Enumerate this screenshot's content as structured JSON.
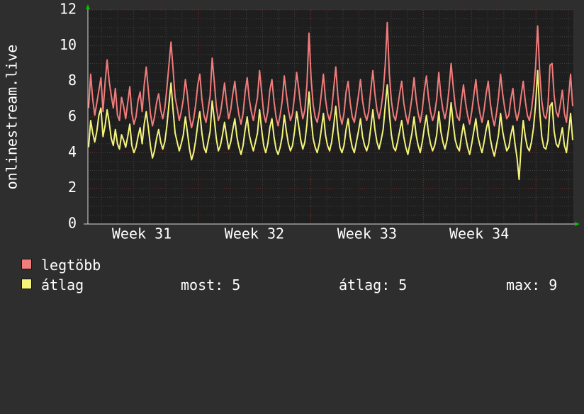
{
  "chart_data": {
    "type": "line",
    "ylabel": "onlinestream.live",
    "ylim": [
      0,
      12
    ],
    "yticks": [
      0,
      2,
      4,
      6,
      8,
      10,
      12
    ],
    "x_ticks": [
      "Week 31",
      "Week 32",
      "Week 33",
      "Week 34"
    ],
    "x_tick_positions": [
      0.111,
      0.343,
      0.575,
      0.806
    ],
    "grid": true,
    "series": [
      {
        "name": "legtöbb",
        "color": "#f07c7c",
        "values": [
          6.5,
          8.4,
          7.0,
          6.1,
          6.8,
          7.5,
          8.2,
          6.3,
          7.9,
          9.2,
          8.0,
          7.2,
          6.5,
          7.6,
          6.1,
          5.8,
          7.1,
          6.6,
          5.9,
          6.8,
          7.7,
          6.2,
          5.6,
          6.0,
          6.9,
          7.4,
          6.3,
          7.8,
          8.8,
          7.5,
          6.2,
          5.5,
          6.0,
          6.8,
          7.3,
          6.4,
          5.9,
          6.5,
          7.6,
          8.9,
          10.2,
          8.7,
          7.1,
          6.5,
          5.8,
          6.3,
          7.0,
          8.1,
          7.2,
          6.0,
          5.4,
          5.9,
          6.7,
          7.8,
          8.4,
          7.0,
          6.1,
          5.7,
          6.4,
          7.2,
          9.3,
          8.0,
          6.6,
          5.8,
          6.2,
          7.0,
          7.9,
          6.8,
          5.9,
          6.4,
          7.3,
          8.0,
          6.9,
          6.1,
          5.6,
          6.2,
          7.4,
          8.2,
          7.0,
          6.3,
          5.8,
          6.5,
          7.1,
          8.6,
          7.4,
          6.2,
          5.7,
          6.3,
          7.5,
          8.1,
          6.9,
          6.0,
          5.5,
          6.1,
          6.9,
          8.3,
          7.3,
          6.4,
          5.8,
          6.2,
          7.2,
          8.5,
          7.6,
          6.6,
          5.9,
          6.4,
          7.8,
          10.7,
          8.2,
          6.7,
          6.0,
          5.7,
          6.3,
          7.3,
          8.4,
          7.0,
          6.2,
          5.8,
          6.4,
          7.6,
          8.8,
          7.2,
          6.1,
          5.6,
          6.2,
          7.4,
          8.0,
          6.8,
          6.0,
          5.7,
          6.4,
          7.2,
          8.1,
          6.9,
          6.2,
          5.8,
          6.3,
          7.5,
          8.6,
          7.3,
          6.4,
          5.9,
          6.5,
          7.4,
          8.9,
          11.3,
          8.4,
          6.9,
          6.1,
          5.8,
          6.5,
          7.3,
          8.0,
          6.8,
          6.1,
          5.6,
          6.3,
          7.1,
          8.2,
          7.0,
          6.2,
          5.7,
          6.4,
          7.5,
          8.3,
          7.1,
          6.3,
          5.8,
          6.2,
          7.0,
          8.5,
          7.2,
          6.4,
          5.9,
          6.5,
          7.6,
          9.0,
          7.7,
          6.6,
          6.0,
          5.8,
          6.9,
          7.8,
          6.8,
          6.1,
          5.6,
          6.3,
          7.2,
          8.1,
          6.9,
          6.2,
          5.7,
          6.4,
          7.3,
          8.0,
          6.8,
          6.0,
          5.5,
          6.2,
          7.1,
          8.4,
          7.3,
          6.5,
          5.9,
          6.1,
          7.0,
          7.6,
          6.4,
          5.8,
          6.3,
          7.2,
          8.0,
          6.9,
          6.1,
          5.8,
          6.4,
          7.4,
          8.8,
          11.1,
          8.5,
          6.9,
          6.1,
          5.9,
          6.6,
          8.9,
          9.0,
          7.2,
          6.3,
          6.0,
          6.7,
          7.5,
          6.2,
          5.7,
          7.1,
          8.4,
          6.6
        ]
      },
      {
        "name": "átlag",
        "color": "#f4f47a",
        "values": [
          4.3,
          5.8,
          5.1,
          4.6,
          5.2,
          6.1,
          6.5,
          4.9,
          5.5,
          6.4,
          5.7,
          4.8,
          4.4,
          5.3,
          4.5,
          4.2,
          5.0,
          4.7,
          4.3,
          4.9,
          5.6,
          4.4,
          4.0,
          4.3,
          4.9,
          5.4,
          4.5,
          5.6,
          6.3,
          5.4,
          4.4,
          3.7,
          4.1,
          4.8,
          5.3,
          4.6,
          4.2,
          4.6,
          5.5,
          6.7,
          7.9,
          6.4,
          5.1,
          4.6,
          4.1,
          4.5,
          5.0,
          6.0,
          5.1,
          4.2,
          3.6,
          4.0,
          4.7,
          5.6,
          6.3,
          5.1,
          4.3,
          4.0,
          4.6,
          5.2,
          6.9,
          5.9,
          4.8,
          4.1,
          4.4,
          5.0,
          5.7,
          4.9,
          4.2,
          4.6,
          5.3,
          5.9,
          4.9,
          4.3,
          3.9,
          4.4,
          5.3,
          6.0,
          5.0,
          4.5,
          4.1,
          4.6,
          5.1,
          6.4,
          5.3,
          4.4,
          4.0,
          4.5,
          5.4,
          5.9,
          4.9,
          4.2,
          3.9,
          4.3,
          4.9,
          6.1,
          5.2,
          4.5,
          4.1,
          4.4,
          5.2,
          6.3,
          5.5,
          4.7,
          4.2,
          4.6,
          5.6,
          7.4,
          6.0,
          4.8,
          4.3,
          4.0,
          4.5,
          5.3,
          6.2,
          5.0,
          4.4,
          4.1,
          4.6,
          5.5,
          6.6,
          5.2,
          4.3,
          4.0,
          4.4,
          5.3,
          5.9,
          4.9,
          4.3,
          4.0,
          4.6,
          5.2,
          5.9,
          4.9,
          4.4,
          4.1,
          4.5,
          5.4,
          6.4,
          5.3,
          4.6,
          4.2,
          4.7,
          5.3,
          6.6,
          7.8,
          6.2,
          5.0,
          4.3,
          4.1,
          4.6,
          5.2,
          5.8,
          4.9,
          4.3,
          3.9,
          4.5,
          5.1,
          6.0,
          5.0,
          4.4,
          4.0,
          4.6,
          5.4,
          6.1,
          5.1,
          4.5,
          4.1,
          4.4,
          5.0,
          6.3,
          5.2,
          4.6,
          4.2,
          4.7,
          5.5,
          6.8,
          5.6,
          4.7,
          4.3,
          4.1,
          4.9,
          5.6,
          4.9,
          4.3,
          3.9,
          4.5,
          5.2,
          5.9,
          4.9,
          4.4,
          4.0,
          4.6,
          5.3,
          5.8,
          4.8,
          4.2,
          3.8,
          4.4,
          5.0,
          6.2,
          5.2,
          4.6,
          4.1,
          4.3,
          5.0,
          5.5,
          4.5,
          3.7,
          2.5,
          4.4,
          5.8,
          4.9,
          4.3,
          4.1,
          4.6,
          5.4,
          6.7,
          8.6,
          6.3,
          4.9,
          4.3,
          4.2,
          4.7,
          6.6,
          6.8,
          5.2,
          4.5,
          4.3,
          4.8,
          5.4,
          4.4,
          4.0,
          5.1,
          6.2,
          4.7
        ]
      }
    ],
    "stats": {
      "most_label": "most:",
      "most_value": "5",
      "atlag_label": "átlag:",
      "atlag_value": "5",
      "max_label": "max:",
      "max_value": "9"
    }
  }
}
